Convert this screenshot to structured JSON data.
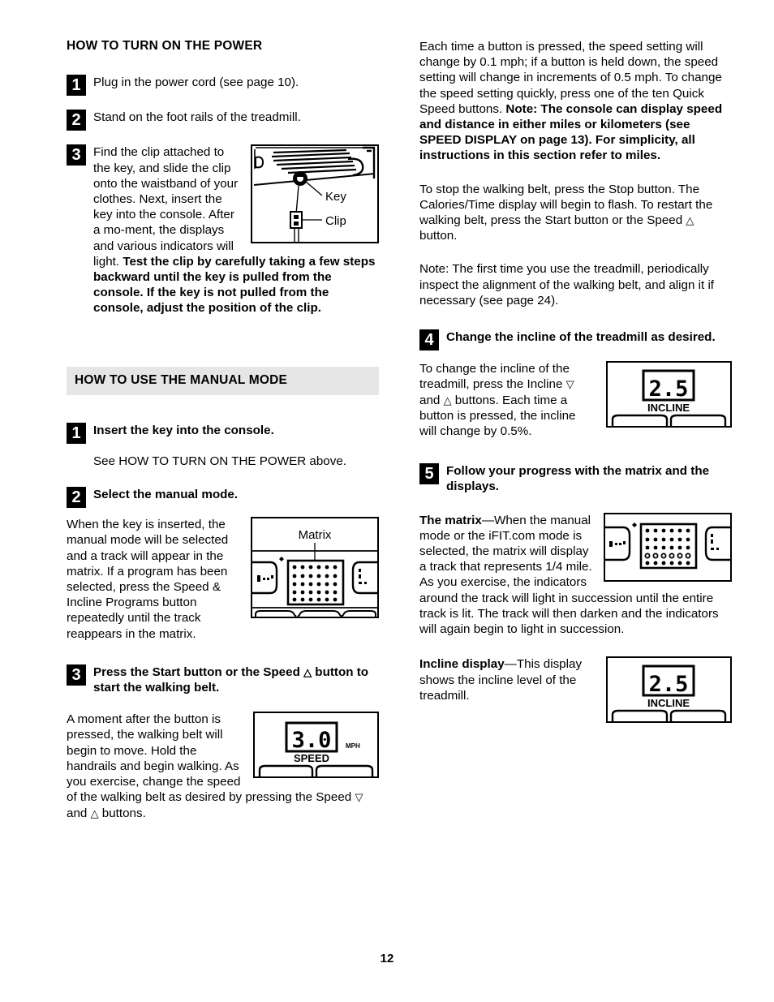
{
  "page": {
    "number": "12"
  },
  "left_column": {
    "heading_power": "HOW TO TURN ON THE POWER",
    "steps_power": [
      {
        "num": "1",
        "text": "Plug in the power cord (see page 10)."
      },
      {
        "num": "2",
        "text": "Stand on the foot rails of the treadmill."
      },
      {
        "num": "3",
        "text_part1": "Find the clip attached to the key, and slide the clip onto the waistband of your clothes. Next, insert the key into the console. After a mo-ment, the displays and various indicators will light. ",
        "text_bold": "Test the clip by carefully taking a few steps backward until the key is pulled from the console. If the key is not pulled from the console, adjust the position of the clip."
      }
    ],
    "figure_keyclip": {
      "label_key": "Key",
      "label_clip": "Clip"
    },
    "heading_manual": "HOW TO USE THE MANUAL MODE",
    "steps_manual": [
      {
        "num": "1",
        "title": "Insert the key into the console.",
        "body": "See HOW TO TURN ON THE POWER above."
      },
      {
        "num": "2",
        "title": "Select the manual mode.",
        "body": "When the key is inserted, the manual mode will be selected and a track will appear in the matrix. If a program has been selected, press the Speed & Incline Programs button repeatedly until the track reappears in the matrix."
      },
      {
        "num": "3",
        "title_part1": "Press the Start button or the Speed ",
        "title_tri": "△",
        "title_part2": " button to start the walking belt.",
        "body_part1": "A moment after the button is pressed, the walking belt will begin to move. Hold the handrails and begin walking. As you exercise, change the speed of the walking belt as desired by pressing the Speed ",
        "body_tri_down": "▽",
        "body_mid": " and ",
        "body_tri_up": "△",
        "body_part2": " buttons."
      }
    ],
    "figure_matrix": {
      "label": "Matrix"
    },
    "figure_speed": {
      "value": "3.0",
      "label": "SPEED",
      "unit": "MPH"
    }
  },
  "right_column": {
    "para_speed_setting_part1": "Each time a button is pressed, the speed setting will change by 0.1 mph; if a button is held down, the speed setting will change in increments of 0.5 mph. To change the speed setting quickly, press one of the ten Quick Speed buttons. ",
    "para_speed_setting_bold": "Note: The console can display speed and distance in either miles or kilometers (see SPEED DISPLAY on page 13). For simplicity, all instructions in this section refer to miles.",
    "para_stop_part1": "To stop the walking belt, press the Stop button. The Calories/Time display will begin to flash. To restart the walking belt, press the Start button or the Speed ",
    "para_stop_tri": "△",
    "para_stop_part2": " button.",
    "para_note_align": "Note: The first time you use the treadmill, periodically inspect the alignment of the walking belt, and align it if necessary (see page 24).",
    "steps": [
      {
        "num": "4",
        "title": "Change the incline of the treadmill as desired.",
        "body_part1": "To change the incline of the treadmill, press the Incline ",
        "body_tri_down": "▽",
        "body_mid": " and ",
        "body_tri_up": "△",
        "body_part2": " buttons. Each time a button is pressed, the incline will change by 0.5%."
      },
      {
        "num": "5",
        "title": "Follow your progress with the matrix and the displays.",
        "matrix_label_bold": "The matrix",
        "matrix_dash": "—",
        "matrix_body": "When the manual mode or the iFIT.com mode is selected, the matrix will display a track that represents 1/4 mile. As you exercise, the indicators around the track will light in succession until the entire track is lit. The track will then darken and the indicators will again begin to light in succession.",
        "incline_label_bold": "Incline display",
        "incline_dash": "—",
        "incline_body": "This display shows the incline level of the treadmill."
      }
    ],
    "figure_incline_step4": {
      "value": "2.5",
      "label": "INCLINE"
    },
    "figure_incline_step5": {
      "value": "2.5",
      "label": "INCLINE"
    }
  },
  "colors": {
    "band_background": "#e6e6e6",
    "text": "#000000",
    "badge_background": "#000000",
    "badge_text": "#ffffff"
  }
}
